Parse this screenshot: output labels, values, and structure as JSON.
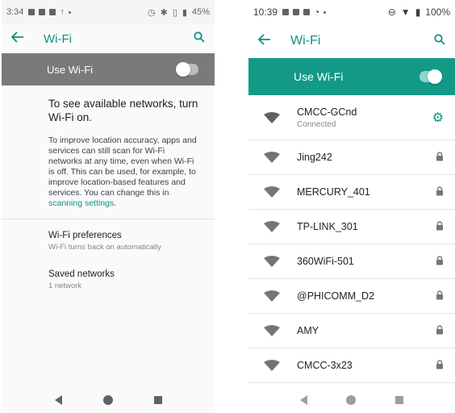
{
  "left": {
    "status": {
      "time": "3:34",
      "battery": "45%"
    },
    "appbar": {
      "title": "Wi-Fi",
      "back_icon": "arrow-left-icon",
      "search_icon": "search-icon"
    },
    "use_wifi": {
      "label": "Use Wi-Fi",
      "state": "off"
    },
    "message": {
      "headline": "To see available networks, turn Wi-Fi on.",
      "body": "To improve location accuracy, apps and services can still scan for Wi-Fi networks at any time, even when Wi-Fi is off. This can be used, for example, to improve location-based features and services. You can change this in ",
      "link": "scanning settings",
      "tail": "."
    },
    "preferences": {
      "title": "Wi-Fi preferences",
      "subtitle": "Wi-Fi turns back on automatically"
    },
    "saved": {
      "title": "Saved networks",
      "subtitle": "1 network"
    }
  },
  "right": {
    "status": {
      "time": "10:39",
      "battery": "100%"
    },
    "appbar": {
      "title": "Wi-Fi",
      "back_icon": "arrow-left-icon",
      "search_icon": "search-icon"
    },
    "use_wifi": {
      "label": "Use Wi-Fi",
      "state": "on"
    },
    "connected": {
      "name": "CMCC-GCnd",
      "status": "Connected"
    },
    "networks": [
      "Jing242",
      "MERCURY_401",
      "TP-LINK_301",
      "360WiFi-501",
      "@PHICOMM_D2",
      "AMY",
      "CMCC-3x23"
    ]
  },
  "colors": {
    "accent": "#0f8f7f",
    "green_bar": "#139a87",
    "grey_bar": "#7a7a7a"
  }
}
